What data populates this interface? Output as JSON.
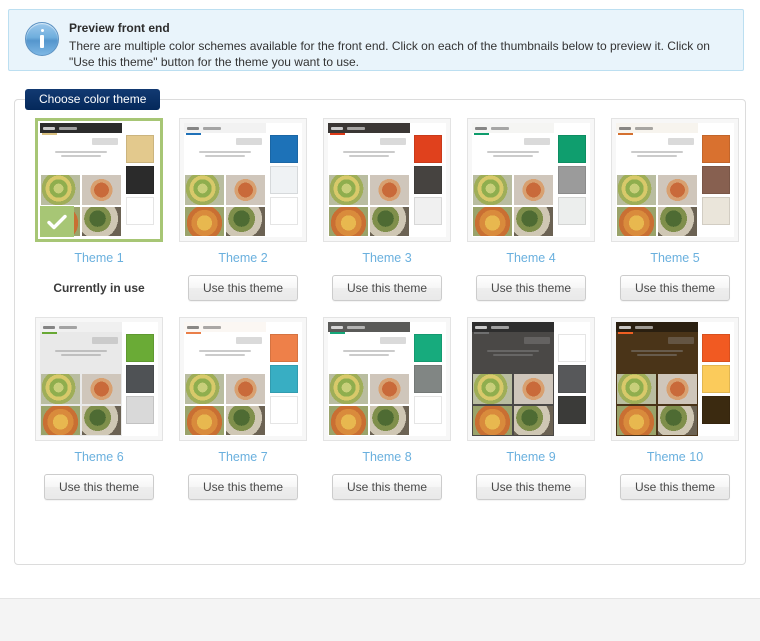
{
  "notice": {
    "icon": "info-icon",
    "title": "Preview front end",
    "body": "There are multiple color schemes available for the front end. Click on each of the thumbnails below to preview it. Click on \"Use this theme\" button for the theme you want to use."
  },
  "panel": {
    "legend": "Choose color theme"
  },
  "labels": {
    "use_theme": "Use this theme",
    "currently_in_use": "Currently in use"
  },
  "colors": {
    "legend_bg": "#0b3167",
    "notice_bg": "#e9f4fb",
    "notice_border": "#bcdff1",
    "link": "#6ab0de",
    "selected_border": "#a7c675",
    "check_badge": "#a7c675"
  },
  "themes": [
    {
      "id": 1,
      "label": "Theme 1",
      "selected": true,
      "status": "Currently in use",
      "header_bg": "#2b2b2b",
      "body_bg": "#ffffff",
      "accent": "#d9c07f",
      "swatches": [
        "#e3c98d",
        "#2b2b2b",
        "#ffffff"
      ]
    },
    {
      "id": 2,
      "label": "Theme 2",
      "selected": false,
      "action": "Use this theme",
      "header_bg": "#f2f2f2",
      "body_bg": "#ffffff",
      "accent": "#1f71b8",
      "swatches": [
        "#1d72b8",
        "#eff2f4",
        "#ffffff"
      ]
    },
    {
      "id": 3,
      "label": "Theme 3",
      "selected": false,
      "action": "Use this theme",
      "header_bg": "#3a3634",
      "body_bg": "#ffffff",
      "accent": "#dd3a18",
      "swatches": [
        "#e0411d",
        "#464340",
        "#f0f0f0"
      ]
    },
    {
      "id": 4,
      "label": "Theme 4",
      "selected": false,
      "action": "Use this theme",
      "header_bg": "#f5f5f3",
      "body_bg": "#ffffff",
      "accent": "#0e9c6c",
      "swatches": [
        "#0f9e6e",
        "#9b9b9b",
        "#eceeed"
      ]
    },
    {
      "id": 5,
      "label": "Theme 5",
      "selected": false,
      "action": "Use this theme",
      "header_bg": "#f7f4ee",
      "body_bg": "#ffffff",
      "accent": "#d4702f",
      "swatches": [
        "#d9712f",
        "#876050",
        "#eae5da"
      ]
    },
    {
      "id": 6,
      "label": "Theme 6",
      "selected": false,
      "action": "Use this theme",
      "header_bg": "#f0f0f0",
      "body_bg": "#e9e9e9",
      "accent": "#68a834",
      "swatches": [
        "#6aab36",
        "#4f5255",
        "#d9d9d9"
      ]
    },
    {
      "id": 7,
      "label": "Theme 7",
      "selected": false,
      "action": "Use this theme",
      "header_bg": "#fbf7f3",
      "body_bg": "#ffffff",
      "accent": "#ea7f49",
      "swatches": [
        "#ee8049",
        "#38aec3",
        "#ffffff"
      ]
    },
    {
      "id": 8,
      "label": "Theme 8",
      "selected": false,
      "action": "Use this theme",
      "header_bg": "#5a5a58",
      "body_bg": "#ffffff",
      "accent": "#16a87a",
      "swatches": [
        "#17ab7d",
        "#818684",
        "#ffffff"
      ]
    },
    {
      "id": 9,
      "label": "Theme 9",
      "selected": false,
      "action": "Use this theme",
      "header_bg": "#2e2e2e",
      "body_bg": "#4a4846",
      "accent": "#6f6f6f",
      "swatches": [
        "#ffffff",
        "#57585a",
        "#3b3b39"
      ]
    },
    {
      "id": 10,
      "label": "Theme 10",
      "selected": false,
      "action": "Use this theme",
      "header_bg": "#2a1f10",
      "body_bg": "#4a3418",
      "accent": "#ef5f22",
      "swatches": [
        "#f15a22",
        "#fbcb5b",
        "#3b2a10"
      ]
    }
  ]
}
